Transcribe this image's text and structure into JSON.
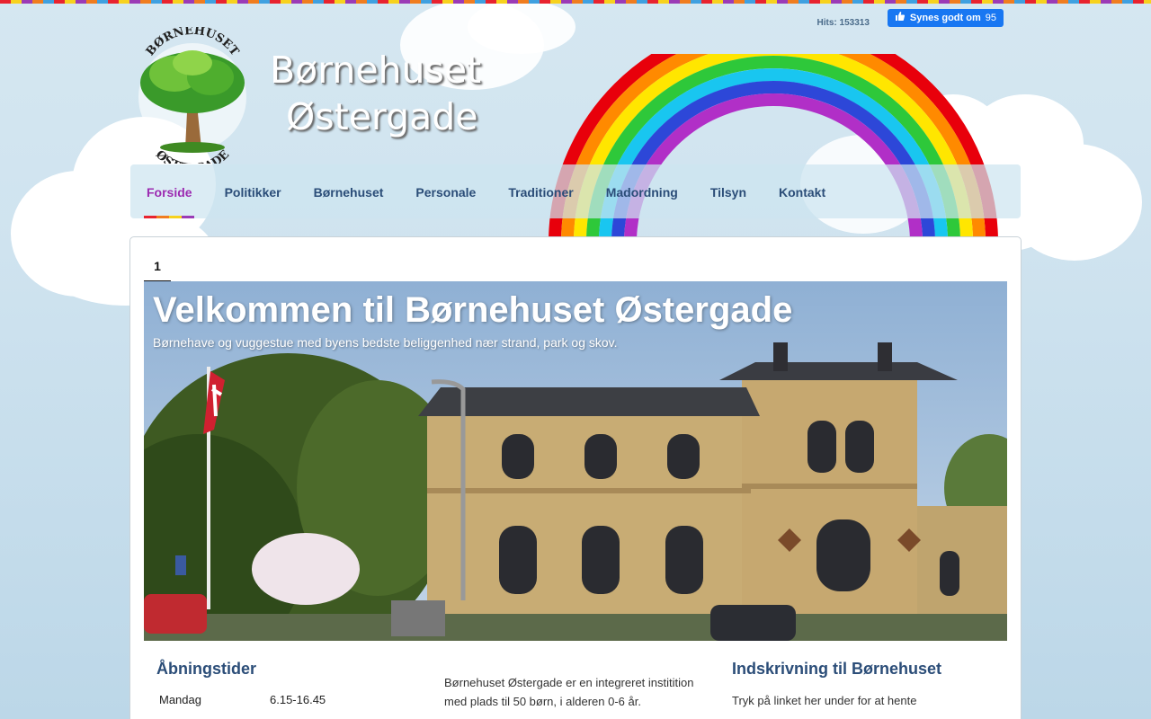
{
  "header": {
    "hits_label": "Hits: 153313",
    "fb_like_label": "Synes godt om",
    "fb_like_count": "95",
    "site_title_line1": "Børnehuset",
    "site_title_line2": "Østergade",
    "logo_text_top": "BØRNEHUSET",
    "logo_text_bottom": "ØSTERGADE"
  },
  "nav": {
    "items": [
      {
        "label": "Forside",
        "active": true
      },
      {
        "label": "Politikker"
      },
      {
        "label": "Børnehuset"
      },
      {
        "label": "Personale"
      },
      {
        "label": "Traditioner"
      },
      {
        "label": "Madordning"
      },
      {
        "label": "Tilsyn"
      },
      {
        "label": "Kontakt"
      }
    ]
  },
  "slider": {
    "tab_label": "1",
    "title": "Velkommen til Børnehuset Østergade",
    "subtitle": "Børnehave og vuggestue med byens bedste beliggenhed nær strand, park og skov."
  },
  "opening_hours": {
    "heading": "Åbningstider",
    "rows": [
      {
        "day": "Mandag",
        "time": "6.15-16.45"
      }
    ]
  },
  "intro": {
    "text_line1": "Børnehuset Østergade er en integreret institition",
    "text_line2": "med plads til 50 børn, i alderen 0-6 år."
  },
  "enrollment": {
    "heading": "Indskrivning til Børnehuset",
    "text": "Tryk på linket her under for at hente"
  },
  "colors": {
    "nav_text": "#2b4d78",
    "nav_active": "#9c2bb1",
    "heading": "#2b4d78",
    "fb_blue": "#1877f2"
  }
}
